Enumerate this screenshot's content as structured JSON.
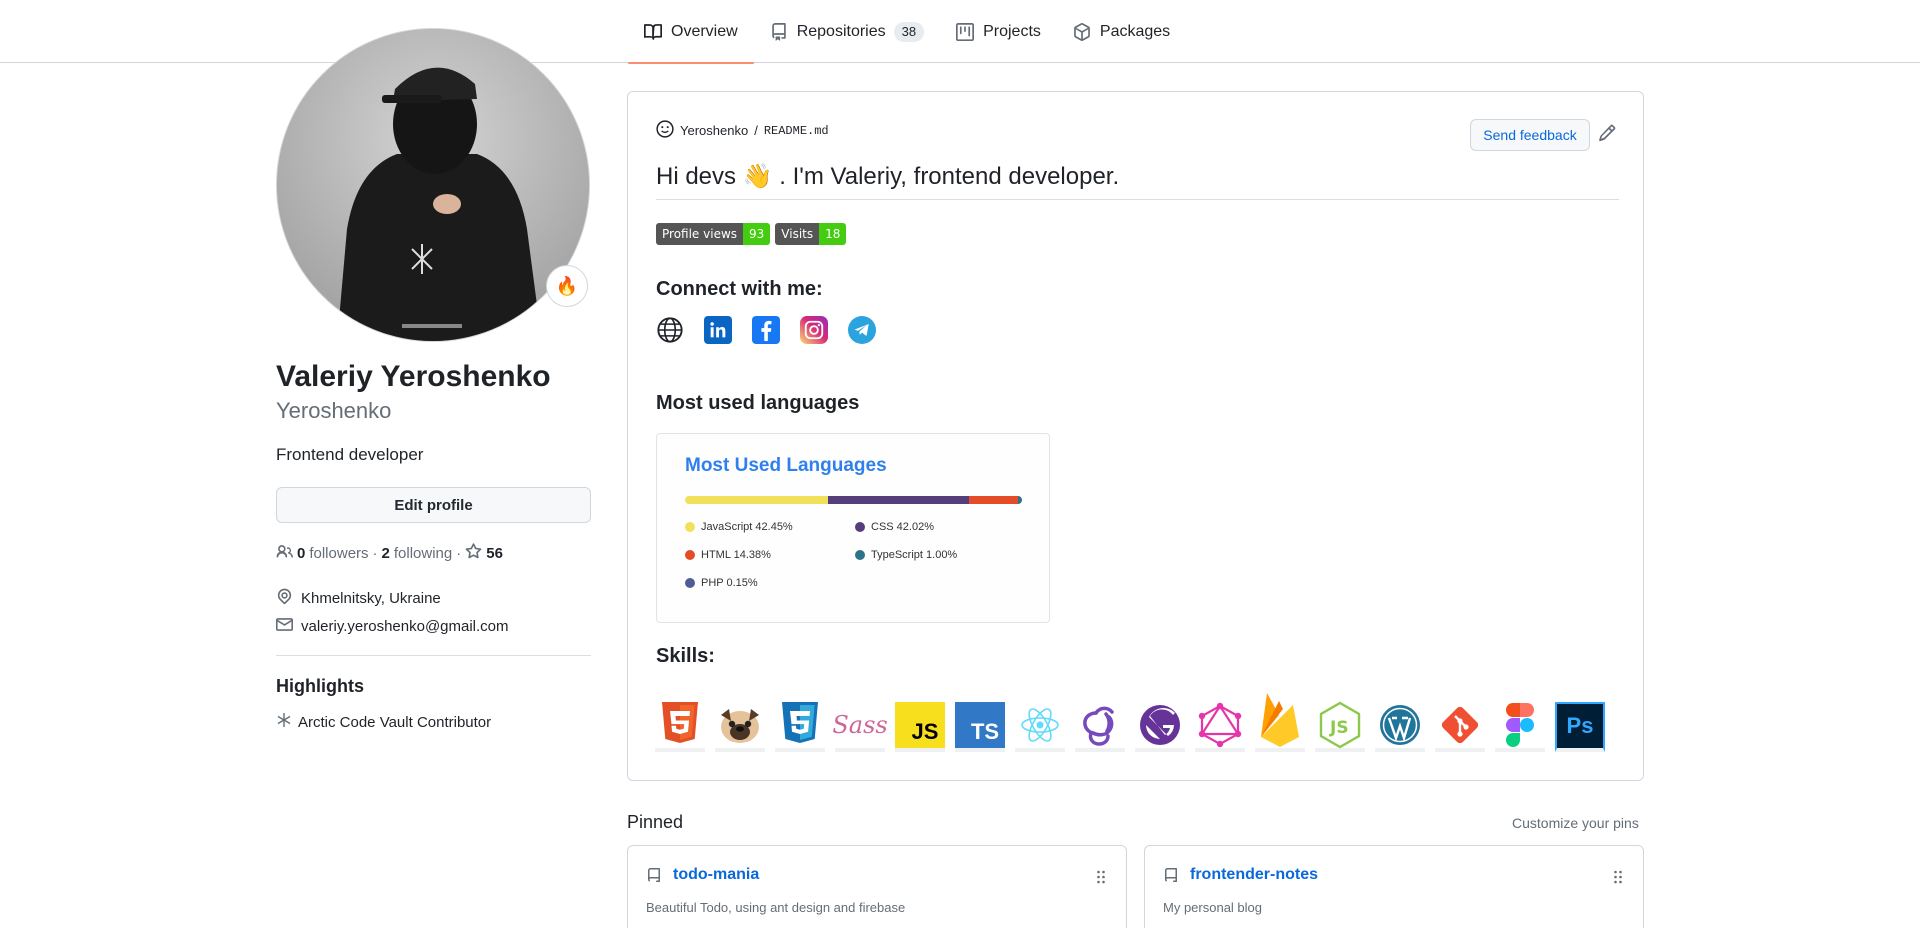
{
  "tabs": [
    {
      "label": "Overview",
      "icon": "book-icon",
      "active": true
    },
    {
      "label": "Repositories",
      "icon": "repo-icon",
      "count": "38"
    },
    {
      "label": "Projects",
      "icon": "project-icon"
    },
    {
      "label": "Packages",
      "icon": "package-icon"
    }
  ],
  "profile": {
    "full_name": "Valeriy Yeroshenko",
    "username": "Yeroshenko",
    "bio": "Frontend developer",
    "edit_label": "Edit profile",
    "status_emoji": "🔥",
    "followers_count": "0",
    "followers_label": "followers",
    "following_count": "2",
    "following_label": "following",
    "stars_count": "56",
    "location": "Khmelnitsky, Ukraine",
    "email": "valeriy.yeroshenko@gmail.com"
  },
  "highlights": {
    "title": "Highlights",
    "item": "Arctic Code Vault Contributor"
  },
  "readme": {
    "owner": "Yeroshenko",
    "separator": "/",
    "file": "README.md",
    "feedback_label": "Send feedback",
    "greeting_pre": "Hi devs",
    "greeting_emoji": "👋",
    "greeting_post": ". I'm Valeriy, frontend developer.",
    "badges": [
      {
        "label": "Profile views",
        "value": "93"
      },
      {
        "label": "Visits",
        "value": "18"
      }
    ],
    "connect_title": "Connect with me:",
    "social": [
      "globe-icon",
      "linkedin-icon",
      "facebook-icon",
      "instagram-icon",
      "telegram-icon"
    ],
    "languages_title": "Most used languages",
    "skills_title": "Skills:",
    "skills": [
      "html5-icon",
      "pug-icon",
      "css3-icon",
      "sass-icon",
      "javascript-icon",
      "typescript-icon",
      "react-icon",
      "redux-icon",
      "gatsby-icon",
      "graphql-icon",
      "firebase-icon",
      "nodejs-icon",
      "wordpress-icon",
      "git-icon",
      "figma-icon",
      "photoshop-icon"
    ]
  },
  "chart_data": {
    "type": "bar",
    "title": "Most Used Languages",
    "categories": [
      "JavaScript",
      "CSS",
      "HTML",
      "TypeScript",
      "PHP"
    ],
    "values": [
      42.45,
      42.02,
      14.38,
      1.0,
      0.15
    ],
    "labels": [
      "JavaScript 42.45%",
      "CSS 42.02%",
      "HTML 14.38%",
      "TypeScript 1.00%",
      "PHP 0.15%"
    ],
    "colors": [
      "#f1e05a",
      "#563d7c",
      "#e34c26",
      "#2b7489",
      "#4F5D95"
    ]
  },
  "pinned": {
    "title": "Pinned",
    "customize_label": "Customize your pins",
    "repos": [
      {
        "name": "todo-mania",
        "description": "Beautiful Todo, using ant design and firebase"
      },
      {
        "name": "frontender-notes",
        "description": "My personal blog"
      }
    ]
  }
}
